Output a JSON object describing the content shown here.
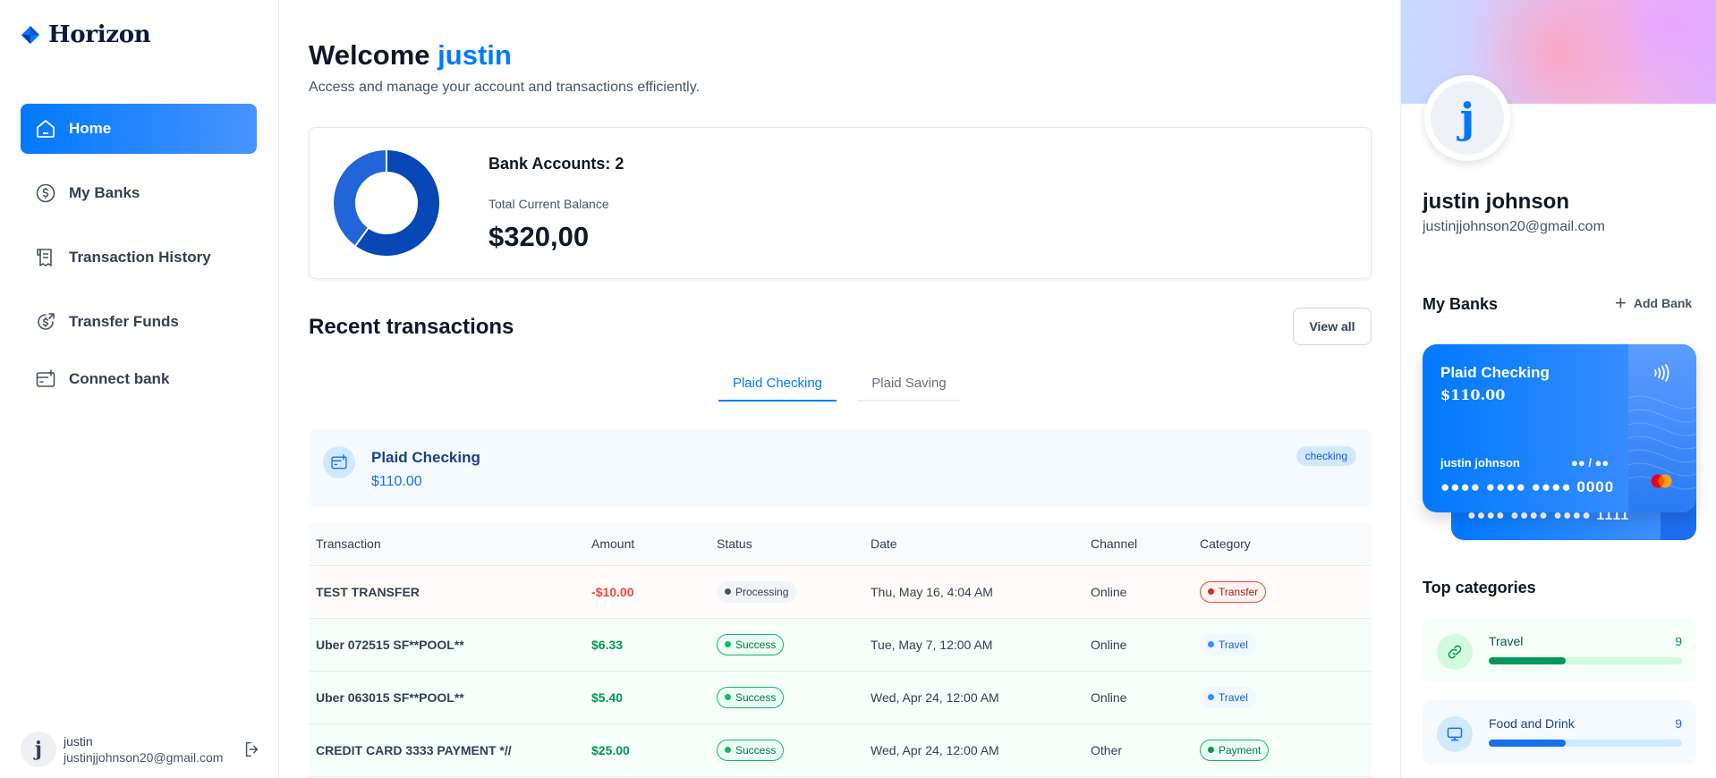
{
  "app": {
    "logo_text": "Horizon"
  },
  "sidebar": {
    "items": [
      {
        "label": "Home",
        "icon": "home-icon",
        "active": true
      },
      {
        "label": "My Banks",
        "icon": "dollar-circle-icon",
        "active": false
      },
      {
        "label": "Transaction History",
        "icon": "receipt-icon",
        "active": false
      },
      {
        "label": "Transfer Funds",
        "icon": "money-send-icon",
        "active": false
      },
      {
        "label": "Connect bank",
        "icon": "connect-bank-icon",
        "active": false
      }
    ],
    "footer": {
      "avatar_initial": "j",
      "name": "justin",
      "email": "justinjjohnson20@gmail.com",
      "logout_icon": "logout-icon"
    }
  },
  "header": {
    "welcome": "Welcome",
    "user_first": "justin",
    "subtitle": "Access and manage your account and transactions efficiently."
  },
  "balance": {
    "bank_accounts_label": "Bank Accounts: 2",
    "total_label": "Total Current Balance",
    "total_value": "$320,00",
    "donut": {
      "shares": [
        0.6,
        0.4
      ],
      "colors": [
        "#0747b6",
        "#2265d8"
      ]
    }
  },
  "recent": {
    "title": "Recent transactions",
    "view_all": "View all",
    "tabs": [
      {
        "label": "Plaid Checking",
        "active": true
      },
      {
        "label": "Plaid Saving",
        "active": false
      }
    ],
    "bank": {
      "name": "Plaid Checking",
      "balance": "$110.00",
      "badge": "checking",
      "icon": "bank-card-add-icon"
    },
    "columns": [
      "Transaction",
      "Amount",
      "Status",
      "Date",
      "Channel",
      "Category"
    ],
    "rows": [
      {
        "name": "TEST TRANSFER",
        "amount": "-$10.00",
        "type": "debit",
        "status": "Processing",
        "status_kind": "processing",
        "date": "Thu, May 16, 4:04 AM",
        "channel": "Online",
        "category": "Transfer",
        "category_kind": "transfer"
      },
      {
        "name": "Uber 072515 SF**POOL**",
        "amount": "$6.33",
        "type": "credit",
        "status": "Success",
        "status_kind": "success",
        "date": "Tue, May 7, 12:00 AM",
        "channel": "Online",
        "category": "Travel",
        "category_kind": "travel"
      },
      {
        "name": "Uber 063015 SF**POOL**",
        "amount": "$5.40",
        "type": "credit",
        "status": "Success",
        "status_kind": "success",
        "date": "Wed, Apr 24, 12:00 AM",
        "channel": "Online",
        "category": "Travel",
        "category_kind": "travel"
      },
      {
        "name": "CREDIT CARD 3333 PAYMENT *//",
        "amount": "$25.00",
        "type": "credit",
        "status": "Success",
        "status_kind": "success",
        "date": "Wed, Apr 24, 12:00 AM",
        "channel": "Other",
        "category": "Payment",
        "category_kind": "payment"
      }
    ]
  },
  "profile": {
    "avatar_initial": "j",
    "name": "justin johnson",
    "email": "justinjjohnson20@gmail.com"
  },
  "my_banks": {
    "title": "My Banks",
    "add_label": "Add Bank",
    "card": {
      "bank_name": "Plaid Checking",
      "balance": "$110.00",
      "holder": "justin johnson",
      "expiry": "●● / ●●",
      "number": "●●●● ●●●● ●●●● 0000"
    },
    "card_back": {
      "number": "●●●● ●●●● ●●●● 1111"
    }
  },
  "top_categories": {
    "title": "Top categories",
    "items": [
      {
        "name": "Travel",
        "count": "9",
        "progress": 0.4,
        "icon": "link-icon"
      },
      {
        "name": "Food and Drink",
        "count": "9",
        "progress": 0.4,
        "icon": "monitor-icon"
      }
    ]
  }
}
